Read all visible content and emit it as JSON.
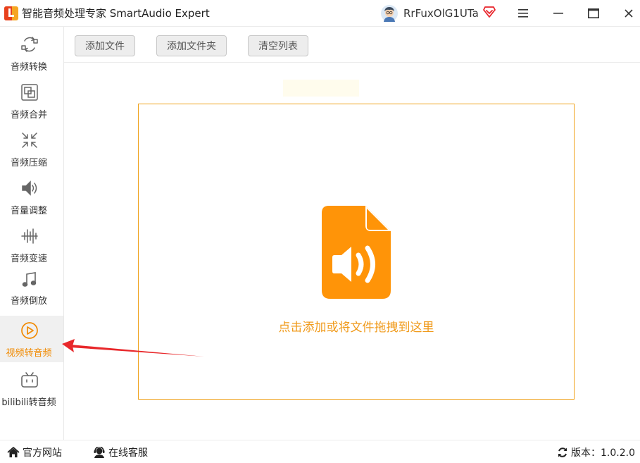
{
  "app": {
    "title": "智能音频处理专家 SmartAudio Expert",
    "accent_color": "#f18a00"
  },
  "user": {
    "name": "RrFuxOlG1UTa"
  },
  "sidebar": {
    "items": [
      {
        "label": "音频转换",
        "icon": "convert-icon",
        "active": false
      },
      {
        "label": "音频合并",
        "icon": "merge-icon",
        "active": false
      },
      {
        "label": "音频压缩",
        "icon": "compress-icon",
        "active": false
      },
      {
        "label": "音量调整",
        "icon": "volume-icon",
        "active": false
      },
      {
        "label": "音频变速",
        "icon": "speed-icon",
        "active": false
      },
      {
        "label": "音频倒放",
        "icon": "music-note-icon",
        "active": false
      },
      {
        "label": "视频转音频",
        "icon": "play-circle-icon",
        "active": true
      },
      {
        "label": "bilibili转音频",
        "icon": "bilibili-tv-icon",
        "active": false
      }
    ]
  },
  "toolbar": {
    "add_file": "添加文件",
    "add_folder": "添加文件夹",
    "clear_list": "清空列表"
  },
  "dropzone": {
    "hint": "点击添加或将文件拖拽到这里",
    "icon": "audio-file-icon"
  },
  "footer": {
    "website": "官方网站",
    "online_service": "在线客服",
    "version": "版本：1.0.2.0"
  }
}
